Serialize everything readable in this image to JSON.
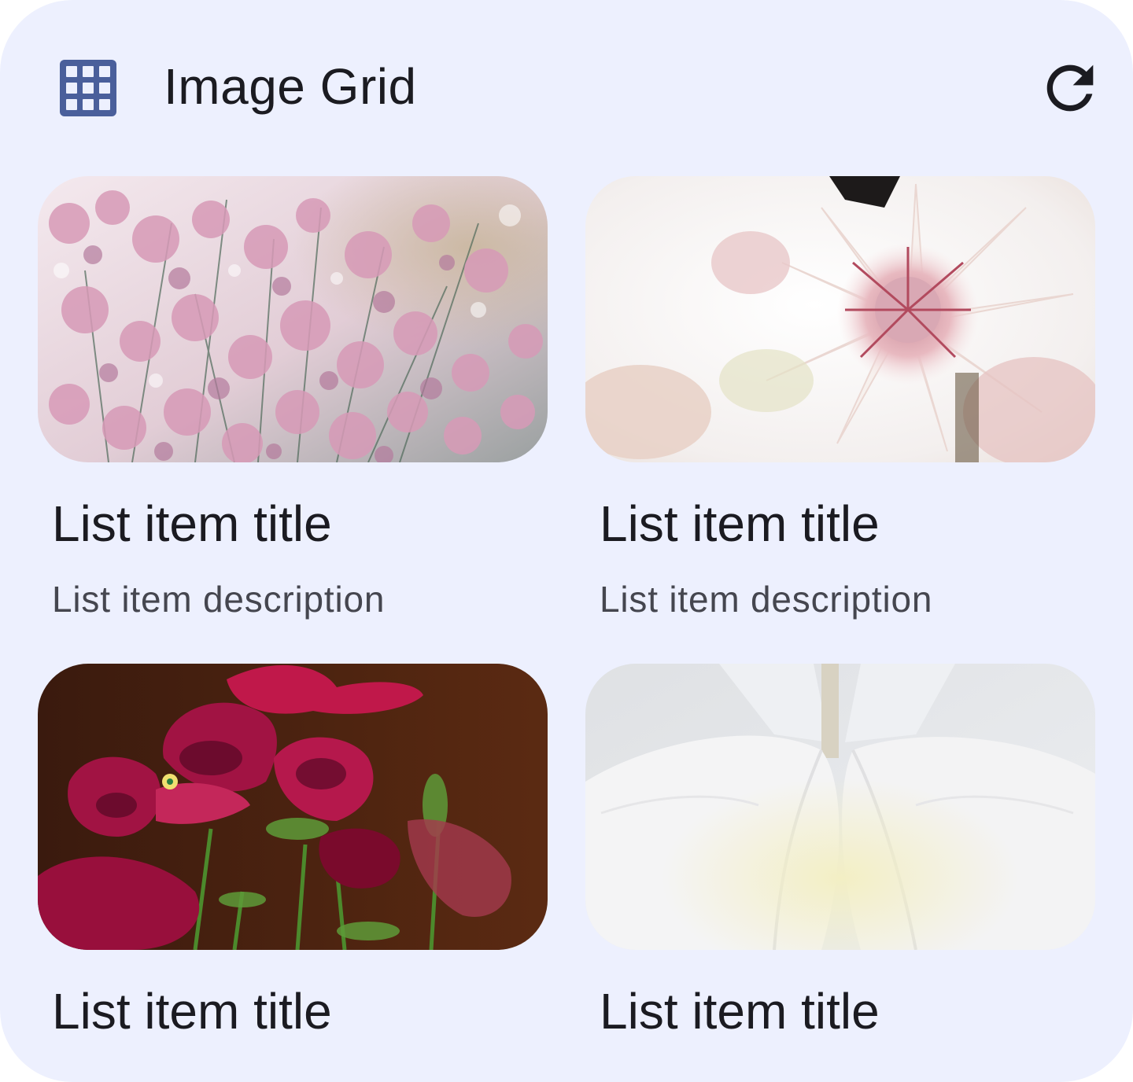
{
  "header": {
    "title": "Image Grid",
    "leading_icon": "grid-icon",
    "action_icon": "refresh-icon"
  },
  "theme": {
    "background": "#edf0fe",
    "icon_accent": "#4a5f9b",
    "text_primary": "#1b1b21",
    "text_secondary": "#45464f"
  },
  "items": [
    {
      "title": "List item title",
      "description": "List item description",
      "image": "pink-limonium-flowers-image"
    },
    {
      "title": "List item title",
      "description": "List item description",
      "image": "blushing-bride-protea-image"
    },
    {
      "title": "List item title",
      "description": "",
      "image": "red-pansy-flowers-image"
    },
    {
      "title": "List item title",
      "description": "",
      "image": "white-orchid-image"
    }
  ]
}
